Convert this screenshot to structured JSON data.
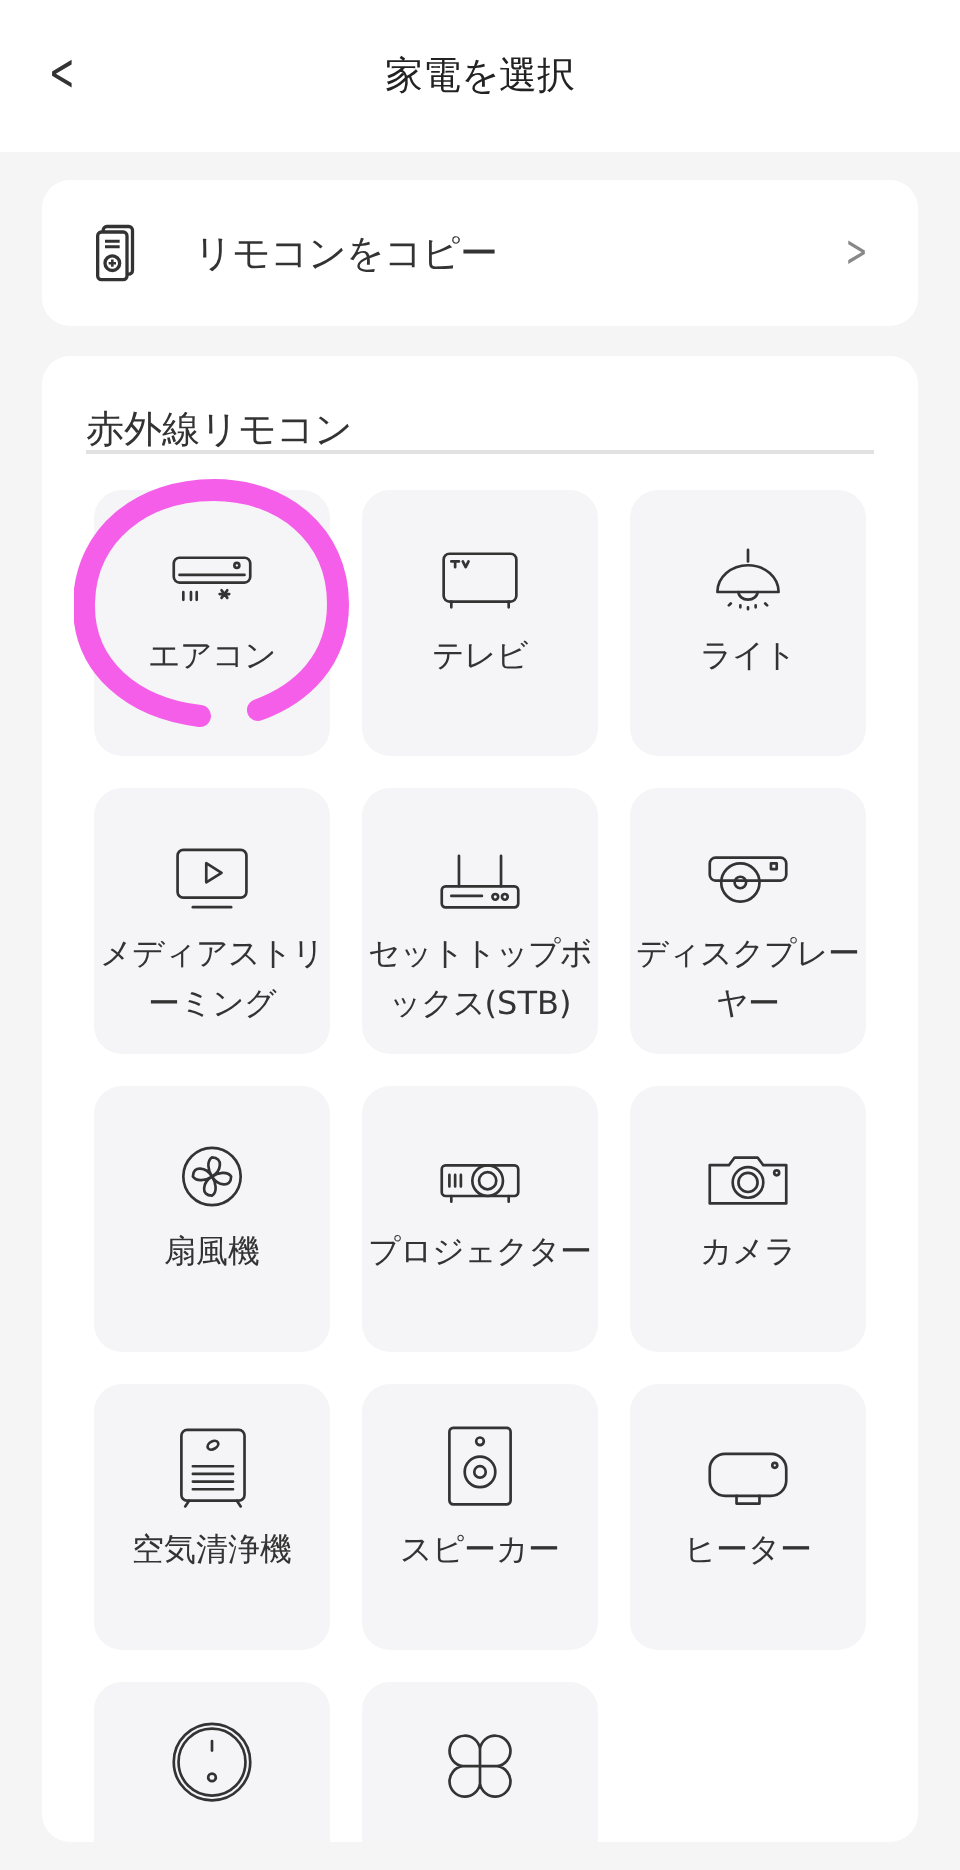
{
  "header": {
    "back": "<",
    "title": "家電を選択"
  },
  "copy_remote": {
    "label": "リモコンをコピー",
    "chevron": ">"
  },
  "ir_section": {
    "title": "赤外線リモコン",
    "items": [
      {
        "kind": "aircon",
        "label": "エアコン",
        "circled": true
      },
      {
        "kind": "tv",
        "label": "テレビ",
        "circled": false
      },
      {
        "kind": "light",
        "label": "ライト",
        "circled": false
      },
      {
        "kind": "streaming",
        "label": "メディアストリーミング",
        "circled": false
      },
      {
        "kind": "stb",
        "label": "セットトップボックス(STB)",
        "circled": false
      },
      {
        "kind": "disc",
        "label": "ディスクプレーヤー",
        "circled": false
      },
      {
        "kind": "fan",
        "label": "扇風機",
        "circled": false
      },
      {
        "kind": "projector",
        "label": "プロジェクター",
        "circled": false
      },
      {
        "kind": "camera",
        "label": "カメラ",
        "circled": false
      },
      {
        "kind": "purifier",
        "label": "空気清浄機",
        "circled": false
      },
      {
        "kind": "speaker",
        "label": "スピーカー",
        "circled": false
      },
      {
        "kind": "heater",
        "label": "ヒーター",
        "circled": false
      },
      {
        "kind": "vacuum",
        "circled": false
      },
      {
        "kind": "other",
        "circled": false
      }
    ]
  }
}
